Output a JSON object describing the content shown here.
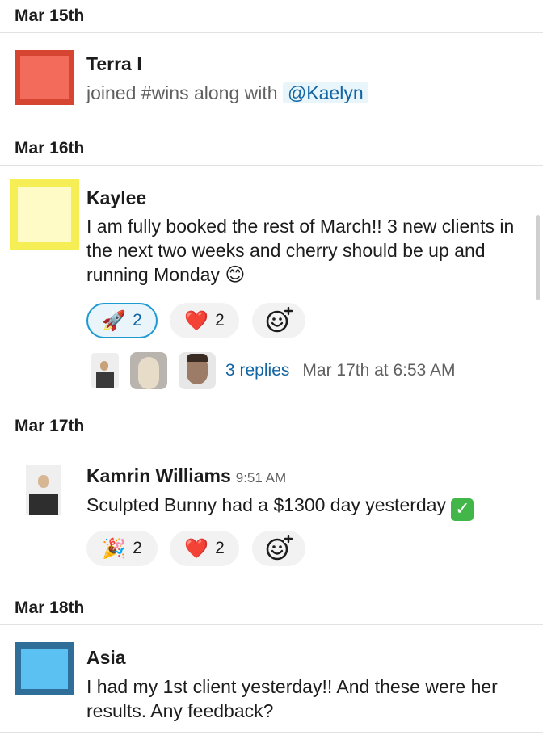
{
  "days": [
    {
      "label": "Mar 15th"
    },
    {
      "label": "Mar 16th"
    },
    {
      "label": "Mar 17th"
    },
    {
      "label": "Mar 18th"
    }
  ],
  "messages": [
    {
      "author": "Terra l",
      "text_prefix": "joined #wins along with",
      "mention": "@Kaelyn",
      "avatar_color": "#d64532"
    },
    {
      "author": "Kaylee",
      "text": "I am fully booked the rest of March!! 3 new clients in the next two weeks and cherry should be up and running Monday",
      "avatar_color": "#f5ef55",
      "reactions": [
        {
          "emoji": "🚀",
          "icon": "rocket-icon",
          "count": "2"
        },
        {
          "emoji": "❤️",
          "icon": "heart-icon",
          "count": "2"
        }
      ],
      "thread": {
        "replies": "3 replies",
        "last_reply": "Mar 17th at 6:53 AM"
      }
    },
    {
      "author": "Kamrin Williams",
      "time": "9:51 AM",
      "text": "Sculpted Bunny had a $1300 day yesterday",
      "reactions": [
        {
          "emoji": "🎉",
          "icon": "party-popper-icon",
          "count": "2"
        },
        {
          "emoji": "❤️",
          "icon": "heart-icon",
          "count": "2"
        }
      ]
    },
    {
      "author": "Asia",
      "text": "I had my 1st client yesterday!! And these were her results. Any feedback?",
      "avatar_color": "#2f6e98"
    }
  ]
}
